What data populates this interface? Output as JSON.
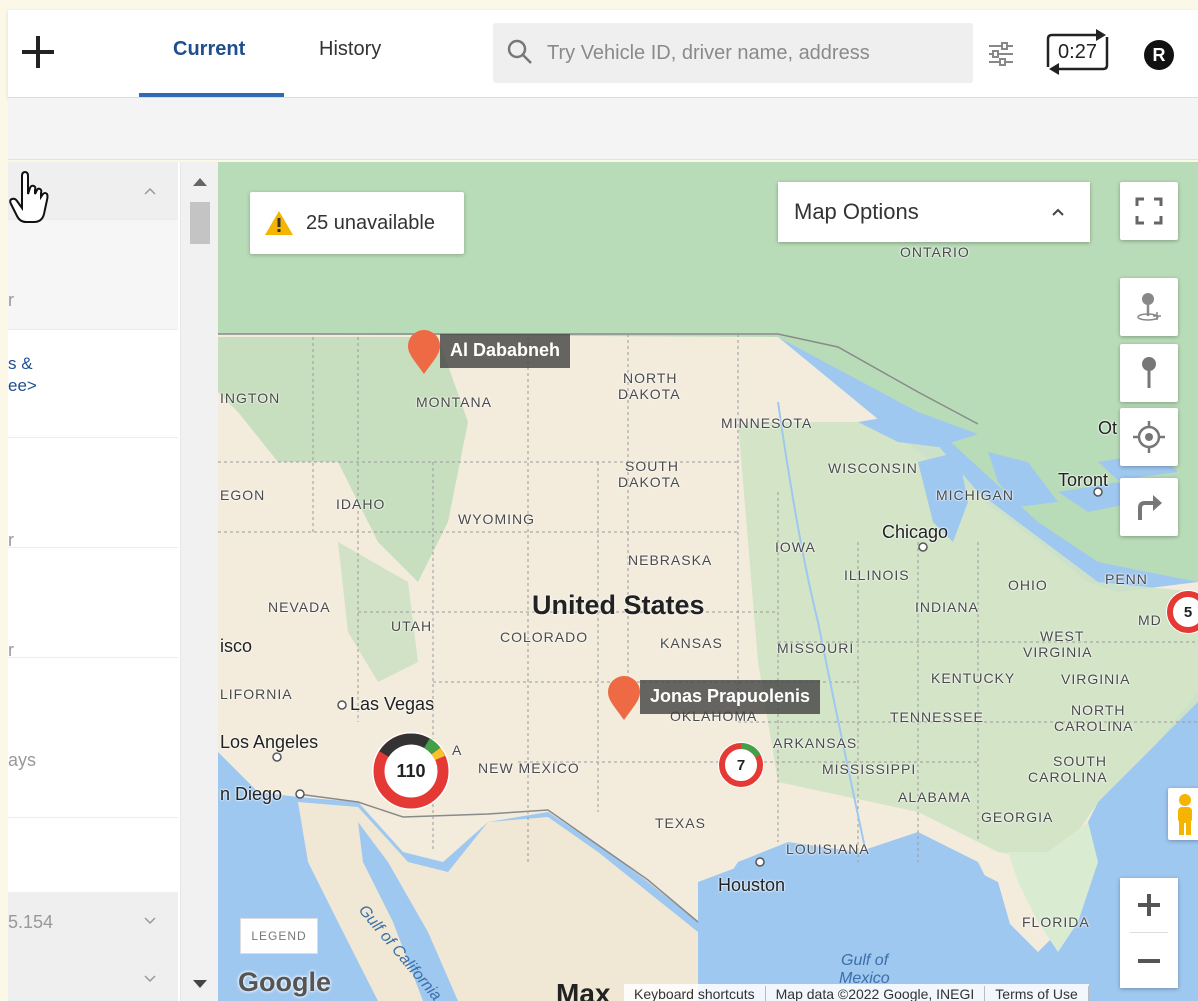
{
  "header": {
    "tabs": [
      {
        "label": "Current",
        "active": true
      },
      {
        "label": "History",
        "active": false
      }
    ],
    "search": {
      "placeholder": "Try Vehicle ID, driver name, address",
      "value": ""
    },
    "timer_label": "0:27",
    "avatar_initial": "R",
    "accent_color": "#2d6bb3"
  },
  "left_panel": {
    "items": [
      {
        "text": "r"
      },
      {
        "text": "s &"
      },
      {
        "text": "ee>"
      },
      {
        "text": "r"
      },
      {
        "text": "r"
      },
      {
        "text": "ays"
      },
      {
        "text": "5.154"
      }
    ]
  },
  "map": {
    "unavailable_label": "25 unavailable",
    "map_options_label": "Map Options",
    "legend_label": "LEGEND",
    "google_label": "Google",
    "attribution": [
      "Keyboard shortcuts",
      "Map data ©2022 Google, INEGI",
      "Terms of Use"
    ],
    "partial_label": "Max",
    "drivers": [
      {
        "name": "Al Dababneh"
      },
      {
        "name": "Jonas Prapuolenis"
      }
    ],
    "clusters": [
      {
        "count": "110",
        "color": "#e53935"
      },
      {
        "count": "7",
        "color": "#e53935"
      },
      {
        "count": "5",
        "color": "#e53935"
      }
    ],
    "labels": {
      "country": "United States",
      "ontario": "ONTARIO",
      "north_dakota_1": "NORTH",
      "north_dakota_2": "DAKOTA",
      "south_dakota_1": "SOUTH",
      "south_dakota_2": "DAKOTA",
      "minnesota": "MINNESOTA",
      "wisconsin": "WISCONSIN",
      "michigan": "MICHIGAN",
      "montana": "MONTANA",
      "ington": "INGTON",
      "idaho": "IDAHO",
      "egon": "EGON",
      "wyoming": "WYOMING",
      "nebraska": "NEBRASKA",
      "iowa": "IOWA",
      "illinois": "ILLINOIS",
      "indiana": "INDIANA",
      "ohio": "OHIO",
      "penn": "PENN",
      "nevada": "NEVADA",
      "utah": "UTAH",
      "colorado": "COLORADO",
      "kansas": "KANSAS",
      "missouri": "MISSOURI",
      "west_virginia_1": "WEST",
      "west_virginia_2": "VIRGINIA",
      "kentucky": "KENTUCKY",
      "virginia": "VIRGINIA",
      "lifornia": "LIFORNIA",
      "oklahoma": "OKLAHOMA",
      "tennessee": "TENNESSEE",
      "north_carolina_1": "NORTH",
      "north_carolina_2": "CAROLINA",
      "arkansas": "ARKANSAS",
      "south_carolina_1": "SOUTH",
      "south_carolina_2": "CAROLINA",
      "new_mexico": "NEW MEXICO",
      "mississippi": "MISSISSIPPI",
      "alabama": "ALABAMA",
      "georgia": "GEORGIA",
      "texas": "TEXAS",
      "louisiana": "LOUISIANA",
      "florida": "FLORIDA",
      "a": "A",
      "md": "MD",
      "chicago": "Chicago",
      "toronto": "Toront",
      "ot": "Ot",
      "isco": "isco",
      "las_vegas": "Las Vegas",
      "los_angeles": "Los Angeles",
      "san_diego": "n Diego",
      "houston": "Houston",
      "gulf_california": "Gulf of California",
      "gulf_mexico_1": "Gulf of",
      "gulf_mexico_2": "Mexico"
    }
  }
}
